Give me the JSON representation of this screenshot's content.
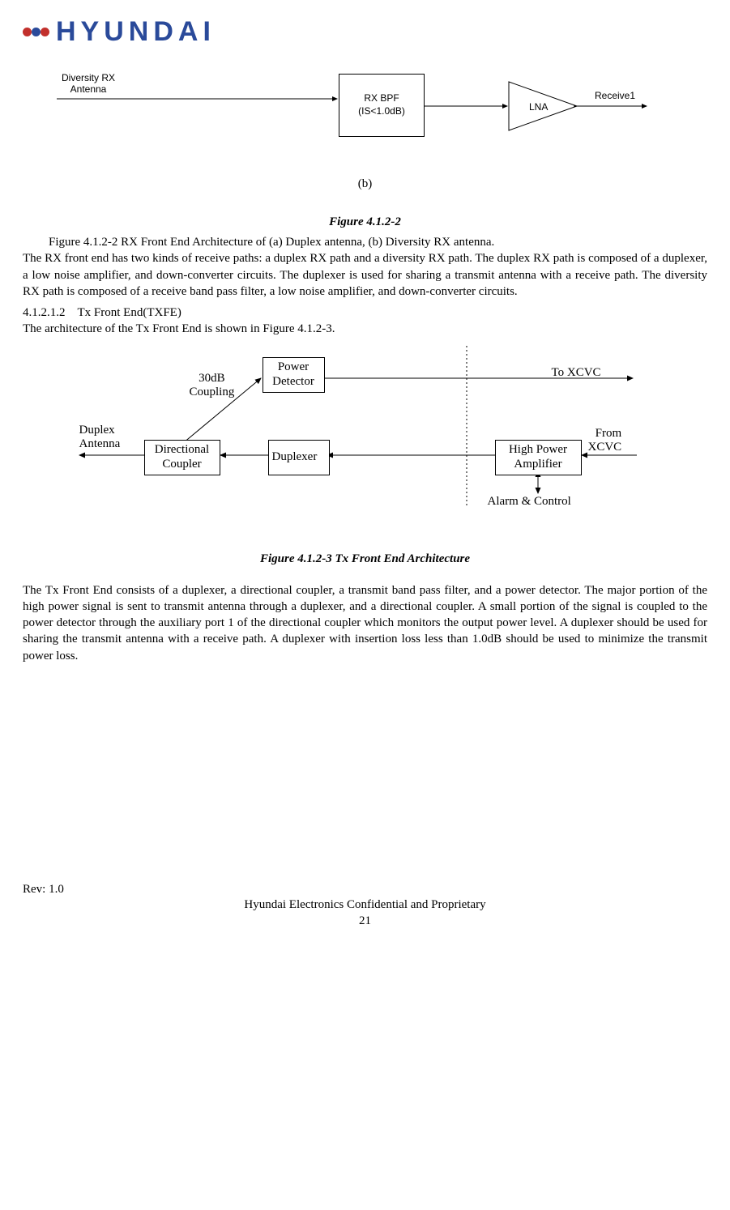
{
  "logo": {
    "brand": "HYUNDAI"
  },
  "diagram1": {
    "left_label_line1": "Diversity RX",
    "left_label_line2": "Antenna",
    "box_line1": "RX BPF",
    "box_line2": "(IS<1.0dB)",
    "lna": "LNA",
    "receive": "Receive1",
    "sublabel": "(b)"
  },
  "figure1": {
    "title": "Figure 4.1.2-2",
    "caption": "Figure 4.1.2-2 RX Front End Architecture of (a) Duplex antenna,  (b) Diversity RX antenna.",
    "paragraph": "The RX front end has two kinds of receive paths: a duplex RX path and a diversity RX path. The duplex RX path is composed of a duplexer, a low noise amplifier, and down-converter circuits. The duplexer is used for sharing a transmit antenna with a receive path. The diversity RX path is composed of a receive band pass filter, a low noise amplifier, and down-converter circuits."
  },
  "section": {
    "heading_num": "4.1.2.1.2",
    "heading_title": "Tx Front End(TXFE)",
    "intro": "The architecture of the Tx Front End is shown in Figure 4.1.2-3."
  },
  "diagram2": {
    "power_detector": "Power\nDetector",
    "coupling": "30dB\nCoupling",
    "duplex_antenna": "Duplex\nAntenna",
    "directional_coupler": "Directional Coupler",
    "duplexer": "Duplexer",
    "hpa": "High Power Amplifier",
    "to_xcvc": "To XCVC",
    "from_xcvc": "From\nXCVC",
    "alarm": "Alarm & Control"
  },
  "figure2": {
    "title": "Figure 4.1.2-3 Tx Front End Architecture",
    "paragraph": "The Tx Front End consists of a duplexer, a directional coupler, a transmit band pass filter, and a power detector. The major portion of the high power signal is sent to transmit antenna through a duplexer, and a directional coupler.  A small portion of the signal is coupled to the power detector through the auxiliary port 1 of the directional coupler which monitors the output power level. A duplexer should be used for sharing the transmit antenna with a receive path. A duplexer with insertion loss less than 1.0dB should be used to minimize the transmit power loss."
  },
  "footer": {
    "rev": "Rev: 1.0",
    "confidential": "Hyundai Electronics Confidential and Proprietary",
    "page": "21"
  }
}
